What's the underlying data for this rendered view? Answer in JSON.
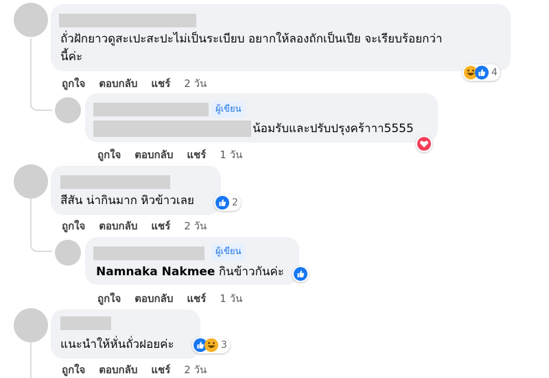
{
  "comments": [
    {
      "text_line1": "ถั่วฝักยาวดูสะเปะสะปะไม่เป็นระเบียบ อยากให้ลองถักเป็นเปีย จะเรียบร้อยกว่า",
      "text_line2": "นี้ค่ะ",
      "reaction_count": "4",
      "actions": {
        "like": "ถูกใจ",
        "reply": "ตอบกลับ",
        "share": "แชร์",
        "time": "2 วัน"
      },
      "reply": {
        "badge": "ผู้เขียน",
        "text": "น้อมรับและปรับปรุงคร้าาา5555",
        "actions": {
          "like": "ถูกใจ",
          "reply": "ตอบกลับ",
          "share": "แชร์",
          "time": "1 วัน"
        }
      }
    },
    {
      "text": "สีสัน น่ากินมาก หิวข้าวเลย",
      "reaction_count": "2",
      "actions": {
        "like": "ถูกใจ",
        "reply": "ตอบกลับ",
        "share": "แชร์",
        "time": "2 วัน"
      },
      "reply": {
        "badge": "ผู้เขียน",
        "mention": "Namnaka Nakmee",
        "text": "กินข้าวกันค่ะ",
        "actions": {
          "like": "ถูกใจ",
          "reply": "ตอบกลับ",
          "share": "แชร์",
          "time": "1 วัน"
        }
      }
    },
    {
      "text": "แนะนำให้หั่นถั่วฝอยค่ะ",
      "reaction_count": "3",
      "actions": {
        "like": "ถูกใจ",
        "reply": "ตอบกลับ",
        "share": "แชร์",
        "time": "2 วัน"
      }
    }
  ],
  "icons": {
    "like": "like-icon",
    "love": "love-icon",
    "haha": "haha-icon"
  },
  "colors": {
    "like": "#1877f2",
    "love": "#f33e58",
    "haha": "#f7b125",
    "badge_text": "#1b74e4"
  }
}
